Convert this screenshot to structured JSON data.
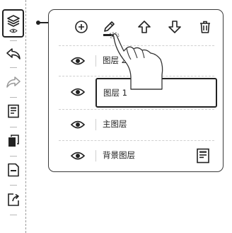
{
  "toolbar": {
    "items": [
      {
        "name": "layers",
        "icon": "layers-icon",
        "active": true
      },
      {
        "name": "undo",
        "icon": "undo-icon"
      },
      {
        "name": "redo",
        "icon": "redo-icon"
      },
      {
        "name": "page",
        "icon": "page-icon"
      },
      {
        "name": "copy",
        "icon": "copy-page-icon"
      },
      {
        "name": "remove-page",
        "icon": "remove-page-icon"
      },
      {
        "name": "export",
        "icon": "export-icon"
      }
    ]
  },
  "layers_panel": {
    "actions": [
      {
        "name": "add",
        "icon": "add-layer-icon"
      },
      {
        "name": "rename",
        "icon": "pencil-icon"
      },
      {
        "name": "move-up",
        "icon": "arrow-up-icon"
      },
      {
        "name": "move-down",
        "icon": "arrow-down-icon"
      },
      {
        "name": "delete",
        "icon": "trash-icon"
      }
    ],
    "layers": [
      {
        "label": "图层 2",
        "visible": true
      },
      {
        "label": "图层 1",
        "visible": true,
        "selected": true
      },
      {
        "label": "主图层",
        "visible": true
      },
      {
        "label": "背景图层",
        "visible": true
      }
    ]
  },
  "colors": {
    "ink": "#222222",
    "divider": "#cfcfcf"
  }
}
